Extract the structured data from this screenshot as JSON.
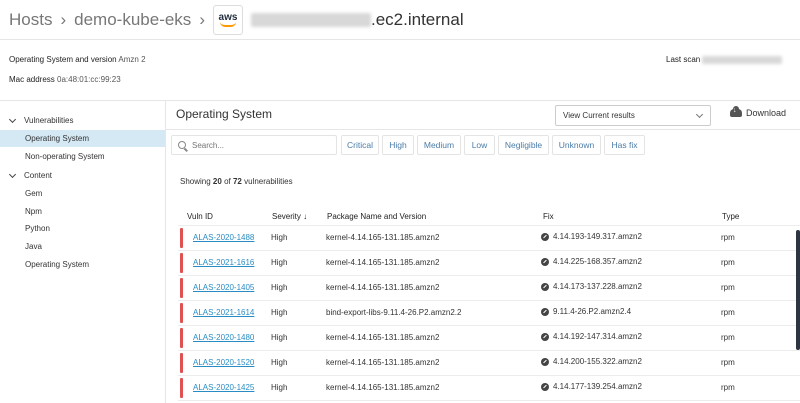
{
  "breadcrumb": {
    "hosts": "Hosts",
    "cluster": "demo-kube-eks",
    "host_suffix": ".ec2.internal",
    "provider_logo": "aws"
  },
  "host_info": {
    "os_label": "Operating System and version",
    "os_value": "Amzn 2",
    "mac_label": "Mac address",
    "mac_value": "0a:48:01:cc:99:23",
    "last_scan_label": "Last scan"
  },
  "sidebar": {
    "sections": [
      {
        "label": "Vulnerabilities",
        "items": [
          "Operating System",
          "Non-operating System"
        ]
      },
      {
        "label": "Content",
        "items": [
          "Gem",
          "Npm",
          "Python",
          "Java",
          "Operating System"
        ]
      }
    ],
    "active": "Operating System"
  },
  "main": {
    "title": "Operating System",
    "view_select": "View Current results",
    "download_label": "Download",
    "search_placeholder": "Search...",
    "filters": [
      "Critical",
      "High",
      "Medium",
      "Low",
      "Negligible",
      "Unknown",
      "Has fix"
    ],
    "showing_prefix": "Showing",
    "showing_count": "20",
    "showing_of": "of",
    "showing_total": "72",
    "showing_suffix": "vulnerabilities",
    "columns": {
      "vuln_id": "Vuln ID",
      "severity": "Severity ↓",
      "package": "Package Name and Version",
      "fix": "Fix",
      "type": "Type"
    },
    "rows": [
      {
        "id": "ALAS-2020-1488",
        "severity": "High",
        "package": "kernel-4.14.165-131.185.amzn2",
        "fix": "4.14.193-149.317.amzn2",
        "type": "rpm"
      },
      {
        "id": "ALAS-2021-1616",
        "severity": "High",
        "package": "kernel-4.14.165-131.185.amzn2",
        "fix": "4.14.225-168.357.amzn2",
        "type": "rpm"
      },
      {
        "id": "ALAS-2020-1405",
        "severity": "High",
        "package": "kernel-4.14.165-131.185.amzn2",
        "fix": "4.14.173-137.228.amzn2",
        "type": "rpm"
      },
      {
        "id": "ALAS-2021-1614",
        "severity": "High",
        "package": "bind-export-libs-9.11.4-26.P2.amzn2.2",
        "fix": "9.11.4-26.P2.amzn2.4",
        "type": "rpm"
      },
      {
        "id": "ALAS-2020-1480",
        "severity": "High",
        "package": "kernel-4.14.165-131.185.amzn2",
        "fix": "4.14.192-147.314.amzn2",
        "type": "rpm"
      },
      {
        "id": "ALAS-2020-1520",
        "severity": "High",
        "package": "kernel-4.14.165-131.185.amzn2",
        "fix": "4.14.200-155.322.amzn2",
        "type": "rpm"
      },
      {
        "id": "ALAS-2020-1425",
        "severity": "High",
        "package": "kernel-4.14.165-131.185.amzn2",
        "fix": "4.14.177-139.254.amzn2",
        "type": "rpm"
      }
    ]
  },
  "colors": {
    "severity_high": "#e05252",
    "link": "#2a8cc4",
    "active_bg": "#d5e9f5",
    "filter_text": "#4a7ca8"
  }
}
